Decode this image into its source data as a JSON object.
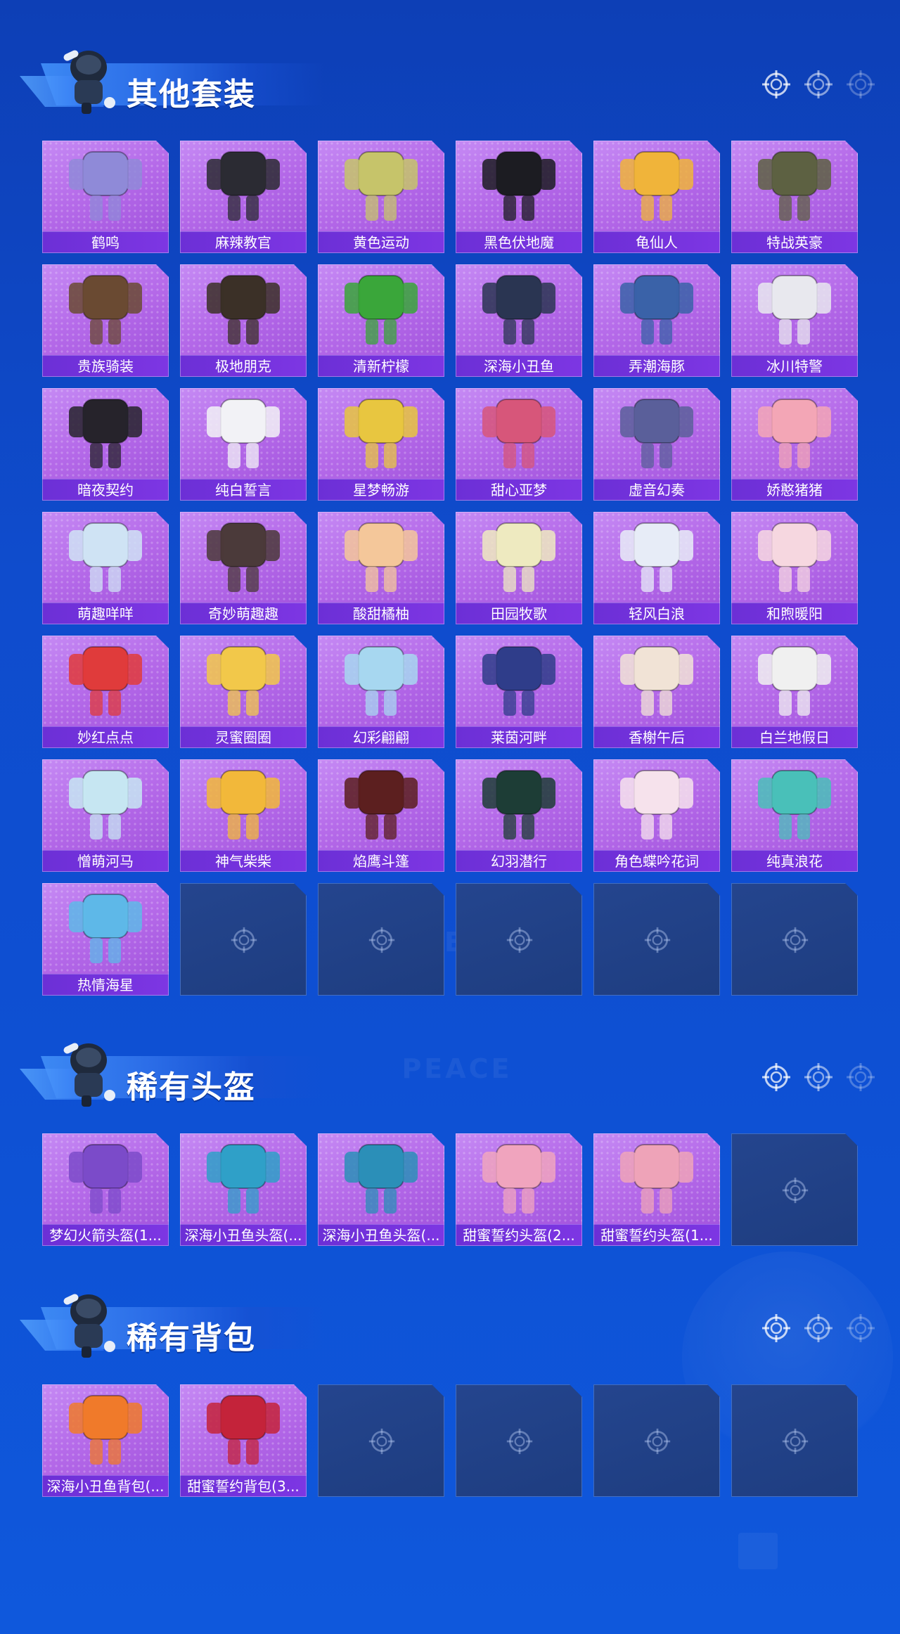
{
  "sections": {
    "outfits": {
      "title": "其他套装",
      "items": [
        {
          "name": "鹤鸣",
          "color": "#8f8ad8"
        },
        {
          "name": "麻辣教官",
          "color": "#2b2b33"
        },
        {
          "name": "黄色运动",
          "color": "#c6c46a"
        },
        {
          "name": "黑色伏地魔",
          "color": "#1c1c22"
        },
        {
          "name": "龟仙人",
          "color": "#f0b43a"
        },
        {
          "name": "特战英豪",
          "color": "#5d6142"
        },
        {
          "name": "贵族骑装",
          "color": "#6a4a32"
        },
        {
          "name": "极地朋克",
          "color": "#3b3027"
        },
        {
          "name": "清新柠檬",
          "color": "#3aa63a"
        },
        {
          "name": "深海小丑鱼",
          "color": "#2a3552"
        },
        {
          "name": "弄潮海豚",
          "color": "#3a62a8"
        },
        {
          "name": "冰川特警",
          "color": "#e8e8ee"
        },
        {
          "name": "暗夜契约",
          "color": "#26232b"
        },
        {
          "name": "纯白誓言",
          "color": "#f2f2f6"
        },
        {
          "name": "星梦畅游",
          "color": "#e8c640"
        },
        {
          "name": "甜心亚梦",
          "color": "#d7567a"
        },
        {
          "name": "虚音幻奏",
          "color": "#5a5f9a"
        },
        {
          "name": "娇憨猪猪",
          "color": "#f3a6b6"
        },
        {
          "name": "萌趣咩咩",
          "color": "#cfe3f4"
        },
        {
          "name": "奇妙萌趣趣",
          "color": "#4b3a3a"
        },
        {
          "name": "酸甜橘柚",
          "color": "#f4c79a"
        },
        {
          "name": "田园牧歌",
          "color": "#eeeac0"
        },
        {
          "name": "轻风白浪",
          "color": "#e7ecf7"
        },
        {
          "name": "和煦暖阳",
          "color": "#f6d7e0"
        },
        {
          "name": "妙红点点",
          "color": "#e03b3b"
        },
        {
          "name": "灵蜜圈圈",
          "color": "#f2c84a"
        },
        {
          "name": "幻彩翩翩",
          "color": "#a7d7f0"
        },
        {
          "name": "莱茵河畔",
          "color": "#2f3d8a"
        },
        {
          "name": "香榭午后",
          "color": "#f1e3d6"
        },
        {
          "name": "白兰地假日",
          "color": "#f0f0f0"
        },
        {
          "name": "憎萌河马",
          "color": "#c6e6f2"
        },
        {
          "name": "神气柴柴",
          "color": "#f2b83a"
        },
        {
          "name": "焰鹰斗篷",
          "color": "#5c1f1f"
        },
        {
          "name": "幻羽潜行",
          "color": "#1d3d36"
        },
        {
          "name": "角色蝶吟花词",
          "color": "#f6e2ec"
        },
        {
          "name": "纯真浪花",
          "color": "#49c0b9"
        },
        {
          "name": "热情海星",
          "color": "#5eb8e8"
        }
      ],
      "empty_slots": 5
    },
    "helmets": {
      "title": "稀有头盔",
      "items": [
        {
          "name": "梦幻火箭头盔(1...",
          "color": "#7b4bc9"
        },
        {
          "name": "深海小丑鱼头盔(...",
          "color": "#2fa0c8"
        },
        {
          "name": "深海小丑鱼头盔(...",
          "color": "#2b8fb8"
        },
        {
          "name": "甜蜜誓约头盔(2...",
          "color": "#f0a4be"
        },
        {
          "name": "甜蜜誓约头盔(1...",
          "color": "#eea3b8"
        }
      ],
      "empty_slots": 1
    },
    "backpacks": {
      "title": "稀有背包",
      "items": [
        {
          "name": "深海小丑鱼背包(...",
          "color": "#f07a2a"
        },
        {
          "name": "甜蜜誓约背包(3...",
          "color": "#c4233a"
        }
      ],
      "empty_slots": 4
    }
  },
  "watermark": "GAME FOR PEACE"
}
